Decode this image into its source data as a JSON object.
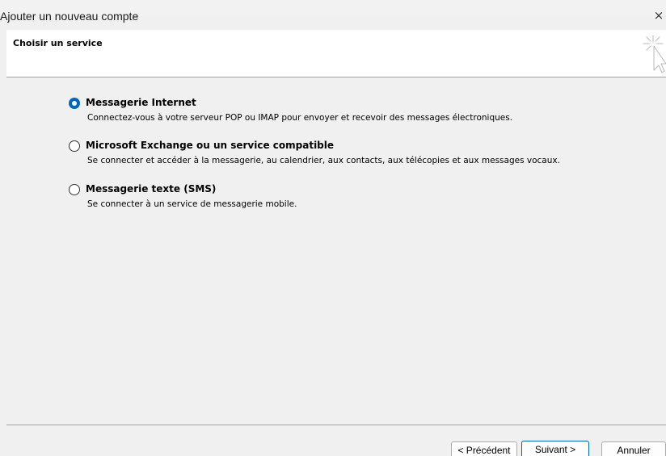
{
  "window": {
    "title": "Ajouter un nouveau compte",
    "close_label": "×"
  },
  "header": {
    "section_title": "Choisir un service",
    "icon": "wizard-cursor-icon"
  },
  "options": [
    {
      "label": "Messagerie Internet",
      "description": "Connectez-vous à votre serveur POP ou IMAP pour envoyer et recevoir des messages électroniques.",
      "checked": true
    },
    {
      "label": "Microsoft Exchange ou un service compatible",
      "description": "Se connecter et accéder à la messagerie, au calendrier, aux contacts, aux télécopies et aux messages vocaux.",
      "checked": false
    },
    {
      "label": "Messagerie texte (SMS)",
      "description": "Se connecter à un service de messagerie mobile.",
      "checked": false
    }
  ],
  "footer": {
    "previous_label": "< Précédent",
    "next_label": "Suivant >",
    "cancel_label": "Annuler"
  },
  "colors": {
    "accent": "#0067c0",
    "header_background": "#ffffff",
    "window_background": "#f0f0f0"
  }
}
